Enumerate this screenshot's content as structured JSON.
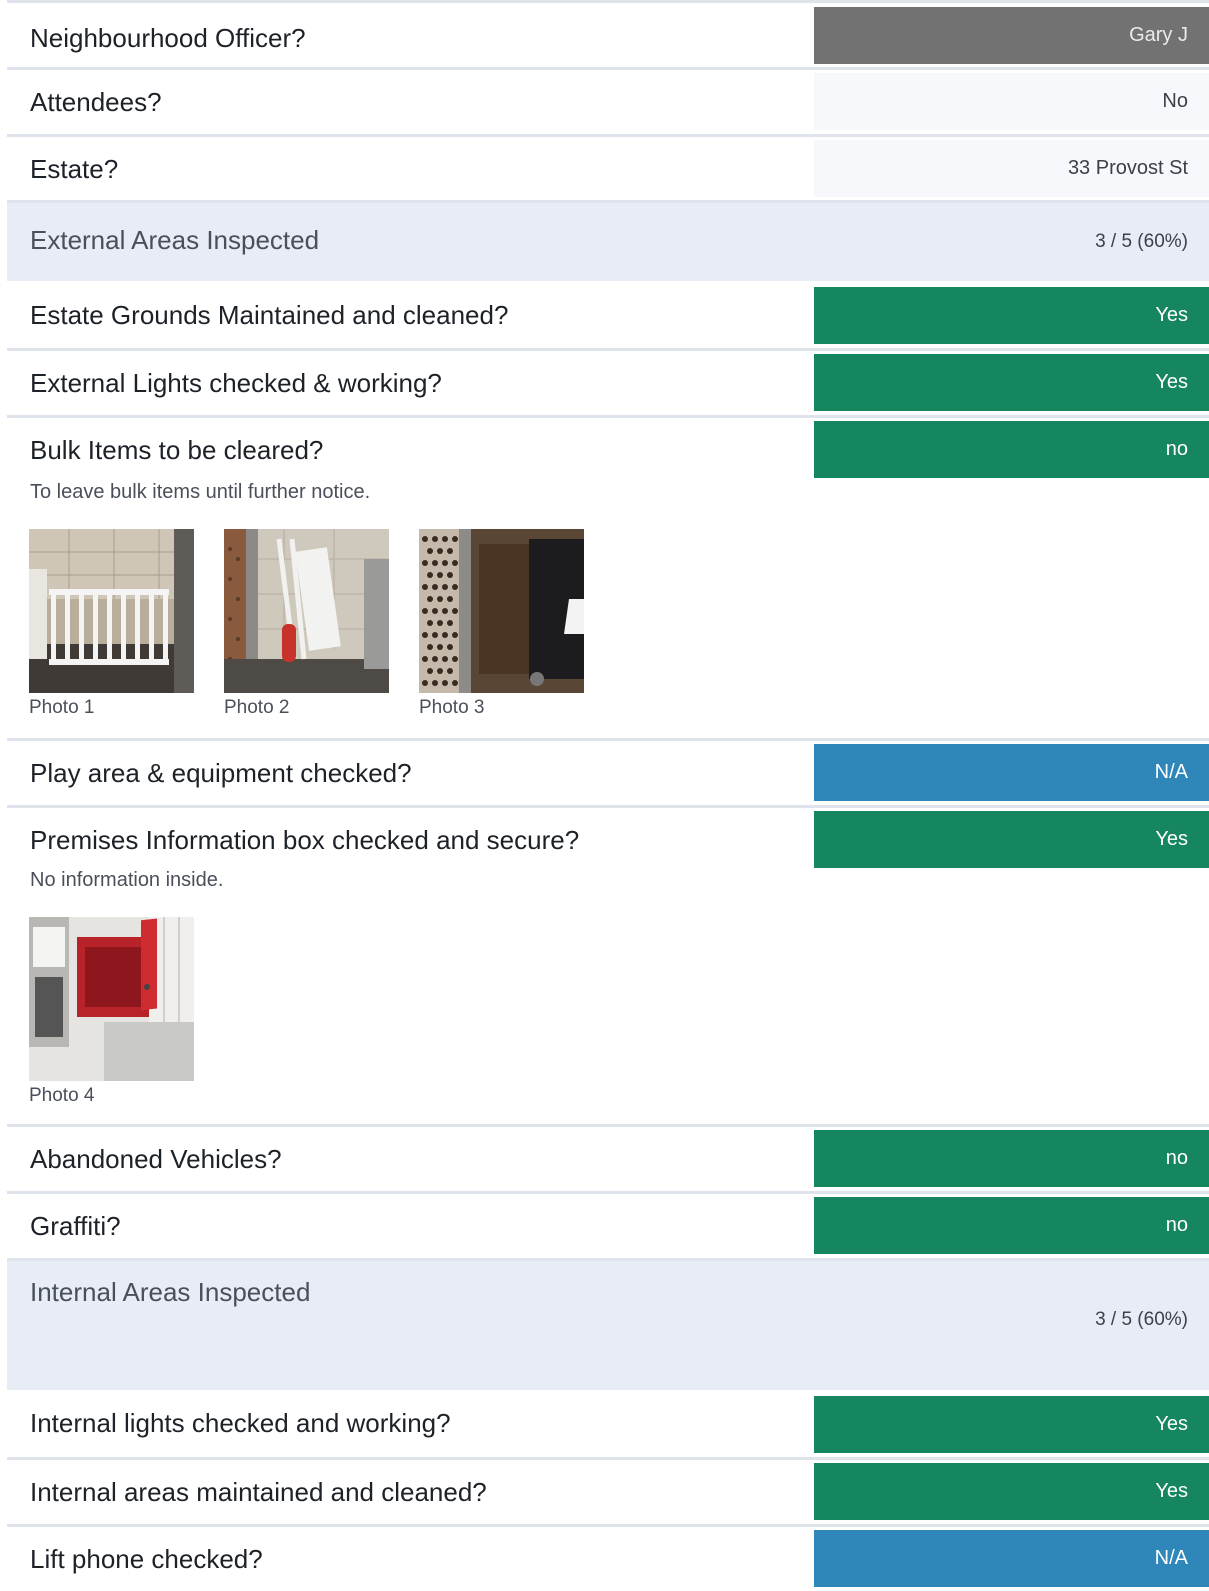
{
  "rows": {
    "officer": {
      "question": "Neighbourhood Officer?",
      "answer": "Gary J"
    },
    "attendees": {
      "question": "Attendees?",
      "answer": "No"
    },
    "estate": {
      "question": "Estate?",
      "answer": "33 Provost St"
    },
    "grounds": {
      "question": "Estate Grounds Maintained and cleaned?",
      "answer": "Yes"
    },
    "ext_lights": {
      "question": "External Lights checked & working?",
      "answer": "Yes"
    },
    "bulk": {
      "question": "Bulk Items to be cleared?",
      "answer": "no",
      "note": "To leave bulk items until further notice."
    },
    "play": {
      "question": "Play area & equipment checked?",
      "answer": "N/A"
    },
    "premises": {
      "question": "Premises Information box checked and secure?",
      "answer": "Yes",
      "note": "No information inside."
    },
    "vehicles": {
      "question": "Abandoned Vehicles?",
      "answer": "no"
    },
    "graffiti": {
      "question": "Graffiti?",
      "answer": "no"
    },
    "int_lights": {
      "question": "Internal lights checked and working?",
      "answer": "Yes"
    },
    "int_areas": {
      "question": "Internal areas maintained and cleaned?",
      "answer": "Yes"
    },
    "lift_phone": {
      "question": "Lift phone checked?",
      "answer": "N/A"
    }
  },
  "sections": {
    "external": {
      "title": "External Areas Inspected",
      "score": "3 / 5 (60%)"
    },
    "internal": {
      "title": "Internal Areas Inspected",
      "score": "3 / 5 (60%)"
    }
  },
  "photos": {
    "p1": {
      "caption": "Photo 1",
      "subject": "cot-in-bin-store"
    },
    "p2": {
      "caption": "Photo 2",
      "subject": "ironing-board-and-extinguisher"
    },
    "p3": {
      "caption": "Photo 3",
      "subject": "wooden-cabinet-and-bin"
    },
    "p4": {
      "caption": "Photo 4",
      "subject": "red-information-box"
    }
  },
  "colors": {
    "grey": "#727272",
    "green": "#15865f",
    "blue": "#2e86b9",
    "section_bg": "#e8ecf5",
    "divider": "#dfe4ec"
  }
}
